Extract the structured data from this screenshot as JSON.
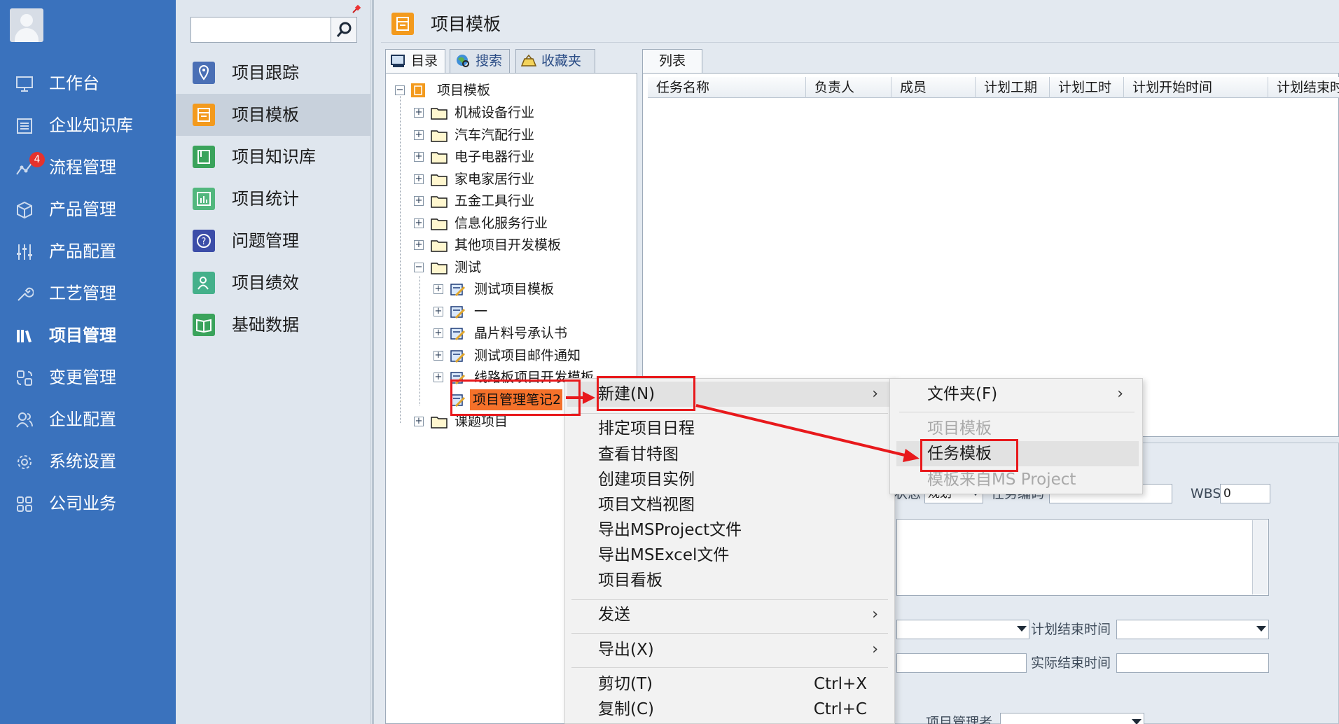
{
  "left_nav": {
    "items": [
      {
        "label": "工作台",
        "icon": "monitor-icon"
      },
      {
        "label": "企业知识库",
        "icon": "list-icon"
      },
      {
        "label": "流程管理",
        "icon": "flow-icon",
        "badge": "4"
      },
      {
        "label": "产品管理",
        "icon": "cube-icon"
      },
      {
        "label": "产品配置",
        "icon": "sliders-icon"
      },
      {
        "label": "工艺管理",
        "icon": "wrench-icon"
      },
      {
        "label": "项目管理",
        "icon": "books-icon",
        "active": true
      },
      {
        "label": "变更管理",
        "icon": "change-icon"
      },
      {
        "label": "企业配置",
        "icon": "users-icon"
      },
      {
        "label": "系统设置",
        "icon": "gear-icon"
      },
      {
        "label": "公司业务",
        "icon": "grid-icon"
      }
    ]
  },
  "sub_nav": {
    "search": {
      "value": "",
      "placeholder": ""
    },
    "items": [
      {
        "label": "项目跟踪",
        "icon": "location-icon",
        "color": "#4a6fb5"
      },
      {
        "label": "项目模板",
        "icon": "template-icon",
        "color": "#f39a1d",
        "active": true
      },
      {
        "label": "项目知识库",
        "icon": "book-icon",
        "color": "#3aa35b"
      },
      {
        "label": "项目统计",
        "icon": "chart-icon",
        "color": "#52b77d"
      },
      {
        "label": "问题管理",
        "icon": "question-icon",
        "color": "#3c4da8"
      },
      {
        "label": "项目绩效",
        "icon": "person-icon",
        "color": "#44b08a"
      },
      {
        "label": "基础数据",
        "icon": "open-book-icon",
        "color": "#3aa35b"
      }
    ]
  },
  "window": {
    "title": "项目模板"
  },
  "left_tabs": [
    {
      "label": "目录",
      "icon": "directory-icon"
    },
    {
      "label": "搜索",
      "icon": "globe-search-icon"
    },
    {
      "label": "收藏夹",
      "icon": "favorites-icon"
    }
  ],
  "tree": {
    "root": "项目模板",
    "folders": [
      "机械设备行业",
      "汽车汽配行业",
      "电子电器行业",
      "家电家居行业",
      "五金工具行业",
      "信息化服务行业",
      "其他项目开发模板",
      "测试"
    ],
    "test_children": [
      "测试项目模板",
      "一",
      "晶片料号承认书",
      "测试项目邮件通知",
      "线路板项目开发模板",
      "项目管理笔记2"
    ],
    "last_folder": "课题项目"
  },
  "grid": {
    "tab": "列表",
    "columns": [
      "任务名称",
      "负责人",
      "成员",
      "计划工期",
      "计划工时",
      "计划开始时间",
      "计划结束时"
    ]
  },
  "form": {
    "status_label": "状态",
    "status_value": "规划",
    "task_code_label": "任务编码",
    "wbs_label": "WBS",
    "wbs_value": "0",
    "plan_end_label": "计划结束时间",
    "actual_end_label": "实际结束时间",
    "manager_label": "项目管理者"
  },
  "context_menu": {
    "items": [
      {
        "label": "新建(N)",
        "submenu": true
      },
      {
        "label": "排定项目日程"
      },
      {
        "label": "查看甘特图"
      },
      {
        "label": "创建项目实例"
      },
      {
        "label": "项目文档视图"
      },
      {
        "label": "导出MSProject文件"
      },
      {
        "label": "导出MSExcel文件"
      },
      {
        "label": "项目看板"
      },
      {
        "label": "发送",
        "submenu": true
      },
      {
        "label": "导出(X)",
        "submenu": true
      },
      {
        "label": "剪切(T)",
        "shortcut": "Ctrl+X"
      },
      {
        "label": "复制(C)",
        "shortcut": "Ctrl+C"
      }
    ]
  },
  "submenu": {
    "items": [
      {
        "label": "文件夹(F)",
        "submenu": true
      },
      {
        "label": "项目模板",
        "disabled": true
      },
      {
        "label": "任务模板"
      },
      {
        "label": "模板来自MS Project",
        "disabled": true
      }
    ]
  },
  "colors": {
    "nav_blue": "#3a72bd",
    "highlight_red": "#e8191c",
    "selected_orange": "#f5712a",
    "badge_red": "#e5322d"
  }
}
